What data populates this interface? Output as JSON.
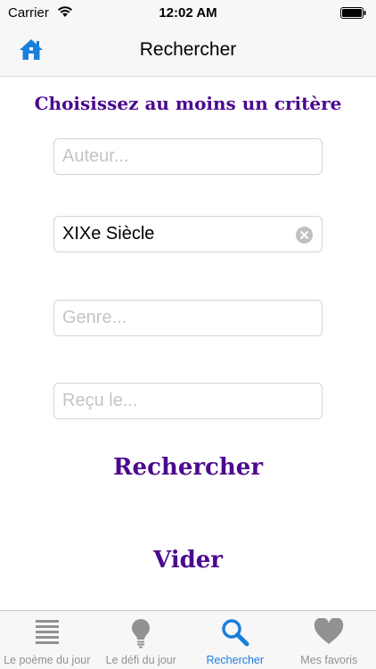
{
  "status_bar": {
    "carrier": "Carrier",
    "time": "12:02 AM"
  },
  "nav": {
    "title": "Rechercher",
    "home_icon": "home-icon"
  },
  "form": {
    "heading": "Choisissez au moins un critère",
    "author": {
      "placeholder": "Auteur...",
      "value": ""
    },
    "period": {
      "placeholder": "",
      "value": "XIXe Siècle"
    },
    "genre": {
      "placeholder": "Genre...",
      "value": ""
    },
    "received": {
      "placeholder": "Reçu le...",
      "value": ""
    },
    "search_label": "Rechercher",
    "clear_label": "Vider"
  },
  "tabs": [
    {
      "label": "Le poème du jour",
      "icon": "list-icon",
      "active": false
    },
    {
      "label": "Le défi du jour",
      "icon": "lightbulb-icon",
      "active": false
    },
    {
      "label": "Rechercher",
      "icon": "search-icon",
      "active": true
    },
    {
      "label": "Mes favoris",
      "icon": "heart-icon",
      "active": false
    }
  ],
  "colors": {
    "accent": "#4b0a8f",
    "tint": "#1a7fdc",
    "inactive": "#929292"
  }
}
